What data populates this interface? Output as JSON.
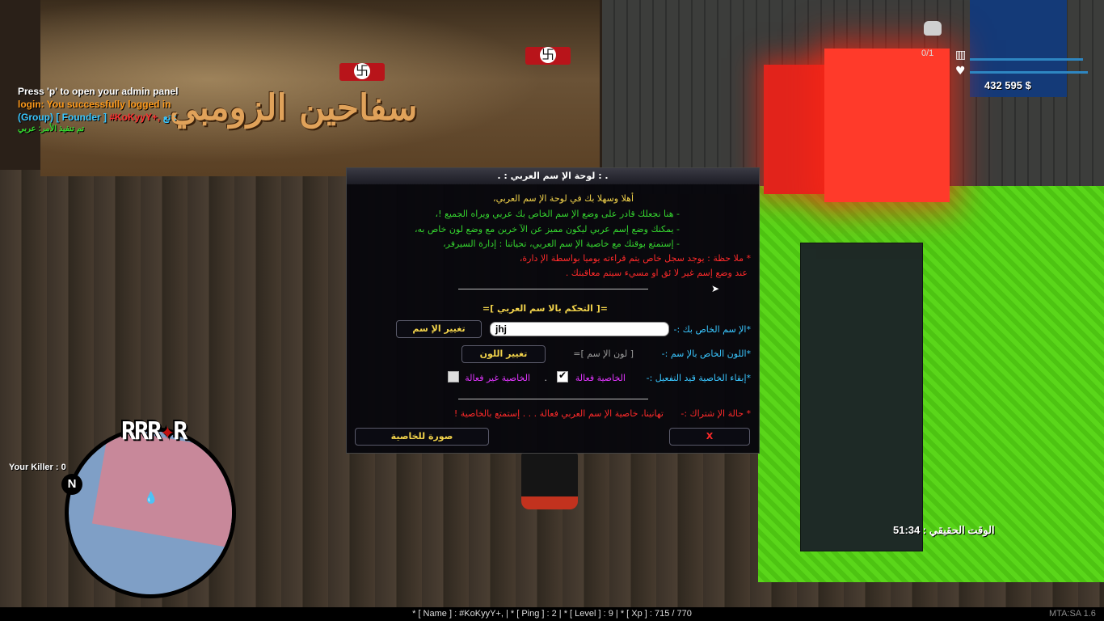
{
  "banner": {
    "title": "سفاحين الزومبي"
  },
  "chat": {
    "lines": [
      {
        "text": "Press 'p' to open your admin panel",
        "color": "#ffffff"
      },
      {
        "text": "login: You successfully logged in",
        "color": "#ff9a1a"
      },
      {
        "parts": [
          {
            "text": "(Group)",
            "color": "#39c6ff"
          },
          {
            "text": " [ Founder ] ",
            "color": "#39c6ff"
          },
          {
            "text": "#KoKyyY+, ",
            "color": "#ff3030"
          },
          {
            "text": "تع :",
            "color": "#39c6ff"
          }
        ]
      },
      {
        "text": "تم تنفيذ الأمر: عربي",
        "color": "#35d62f"
      }
    ]
  },
  "hud": {
    "money": "432 595 $",
    "ammo": "0/1"
  },
  "minimap": {
    "north_label": "N",
    "blip_text": "RRR",
    "blip_suffix": "R"
  },
  "killer": "Your Killer : 0",
  "real_time": "الوقت الحقيقي : 51:34",
  "status_bar": "* [ Name ] : #KoKyyY+, | * [ Ping ] : 2 | * [ Level ] : 9 | * [ Xp ] : 715 / 770",
  "mta_version": "MTA:SA 1.6",
  "dialog": {
    "title": ". : لوحة الإ سم العربي : .",
    "welcome": "أهلا  وسهلا  بك في لوحة الإ سم العربي،",
    "info1": "- هنا نجعلك قادر على وضع الإ سم الخاص بك عربي ويراه الجميع !،",
    "info2": "- يمكنك وضع إسم عربي ليكون مميز عن الآ خرين مع وضع لون خاص به،",
    "info3": "- إستمتع بوقتك مع خاصية الإ سم العربي، تحياتنا : إدارة السيرفر،",
    "note1": "* ملا حظة : يوجد سجل خاص يتم قراءته يوميا بواسطة الإ دارة،",
    "note2": "عند وضع إسم غير لا ئق او مسيء سيتم معاقبتك .",
    "section_title": "=[ التحكم بالا سم العربي ]=",
    "name_label": "*الإ سم الخاص بك :-",
    "name_value": "jhj",
    "change_name_button": "تغيير الإ سم",
    "color_label": "*اللون الخاص بالإ سم :-",
    "color_value": "[ لون الإ سم ]=",
    "change_color_button": "تغيير اللون",
    "keep_label": "*إبقاء الخاصية قيد التفعيل :-",
    "option_on": "الخاصية فعالة",
    "option_on_checked": true,
    "option_dot": ".",
    "option_off": "الخاصية غير فعالة",
    "option_off_checked": false,
    "sub_label": "* حالة الإ شتراك :-",
    "sub_status": "تهانينا، خاصية الإ سم العربي فعالة . . . إستمتع بالخاصية !",
    "image_button": "صورة للخاصية",
    "close_button": "X"
  },
  "colors": {
    "accent_green": "#35d62f",
    "accent_red": "#ff2a2a",
    "accent_yellow": "#f2d34b",
    "accent_cyan": "#39c6ff",
    "accent_magenta": "#e236ff"
  }
}
